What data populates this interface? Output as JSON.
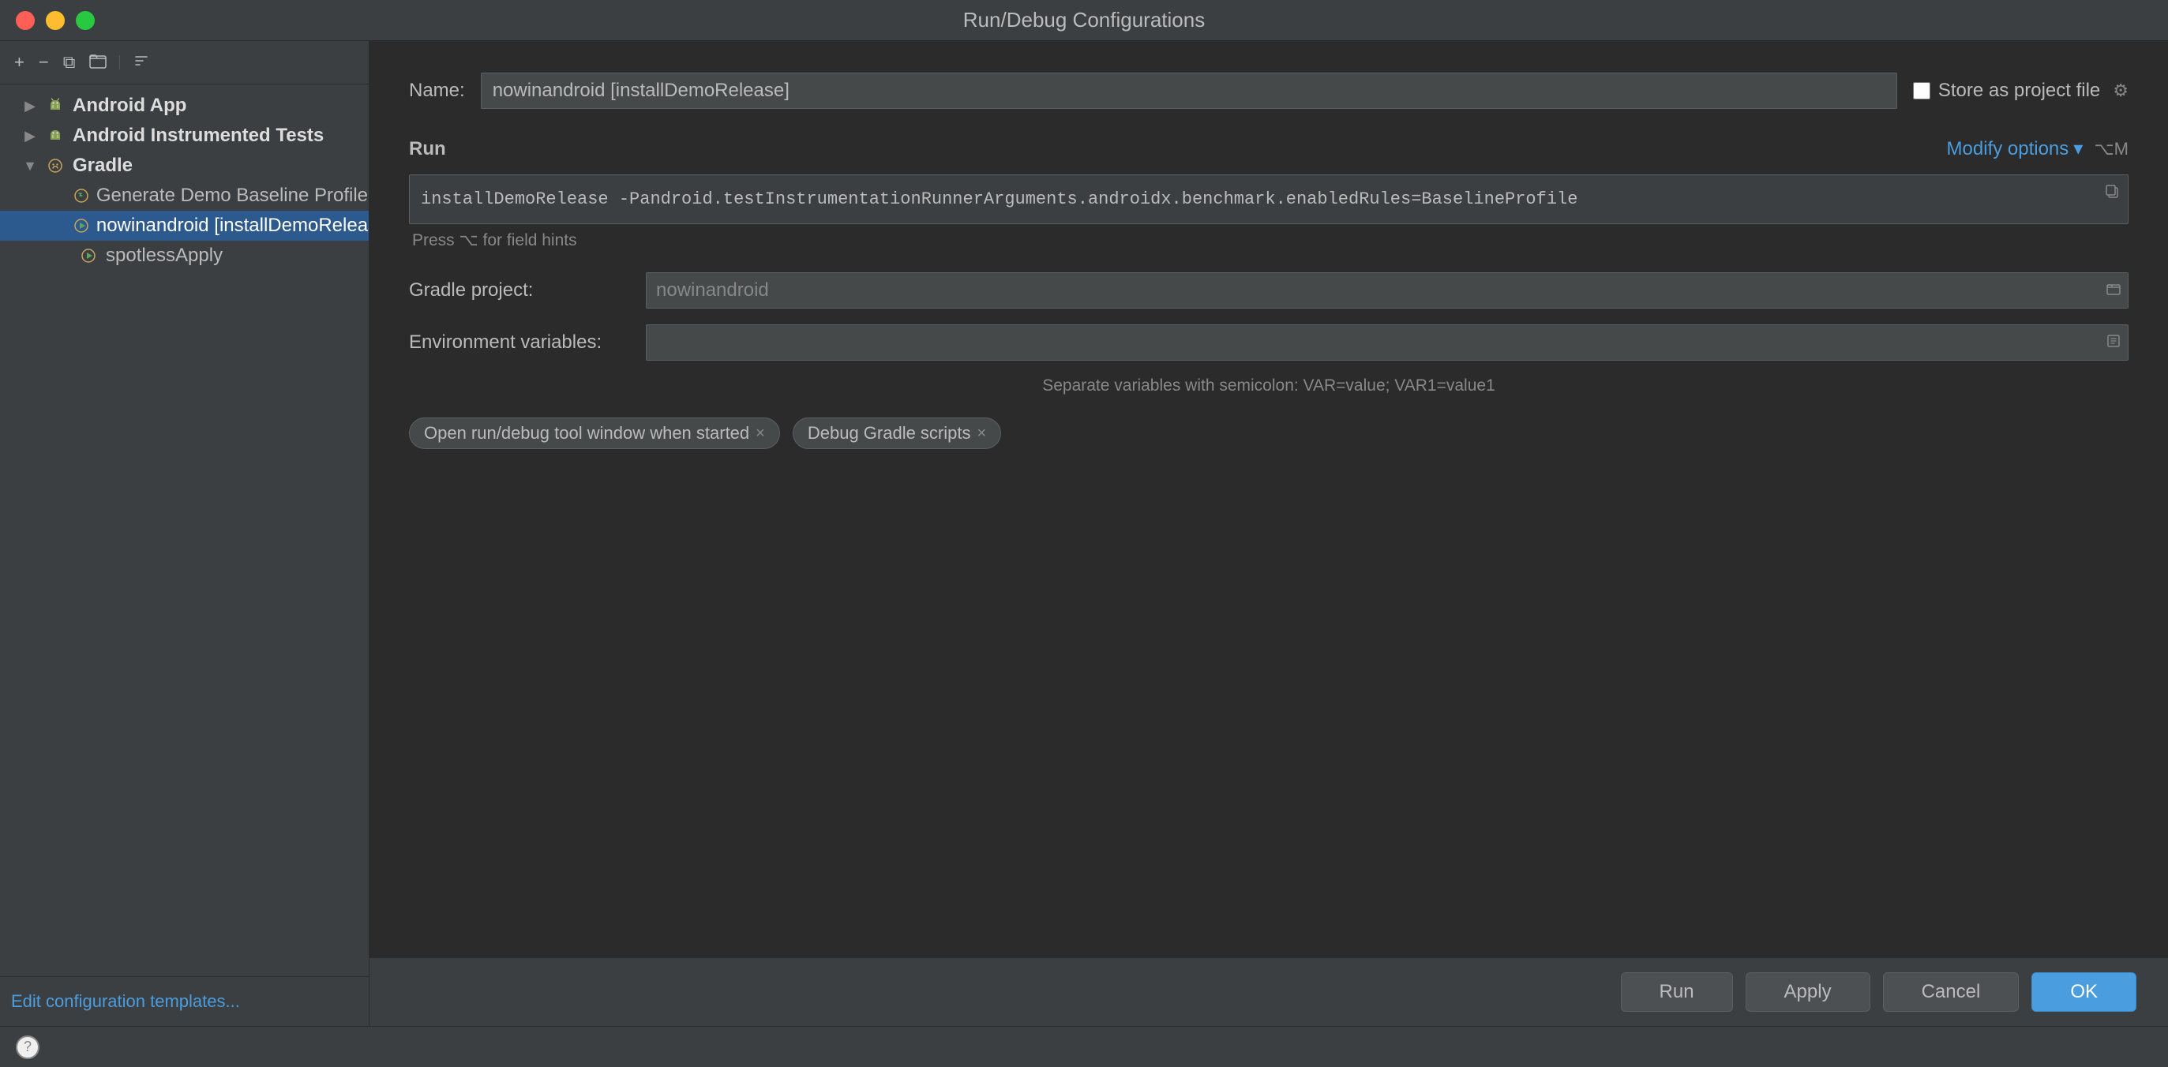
{
  "window": {
    "title": "Run/Debug Configurations"
  },
  "titlebar": {
    "title": "Run/Debug Configurations"
  },
  "sidebar": {
    "toolbar": {
      "add_label": "+",
      "remove_label": "−",
      "copy_label": "⧉",
      "folder_label": "📁",
      "sort_label": "⇅"
    },
    "tree": [
      {
        "id": "android-app",
        "level": 1,
        "arrow": "▶",
        "label": "Android App",
        "bold": true,
        "icon": "android"
      },
      {
        "id": "android-instrumented",
        "level": 1,
        "arrow": "▶",
        "label": "Android Instrumented Tests",
        "bold": true,
        "icon": "android"
      },
      {
        "id": "gradle",
        "level": 1,
        "arrow": "▼",
        "label": "Gradle",
        "bold": true,
        "icon": "gradle"
      },
      {
        "id": "generate-demo",
        "level": 2,
        "arrow": "",
        "label": "Generate Demo Baseline Profile",
        "bold": false,
        "icon": "run"
      },
      {
        "id": "nowinandroid-install",
        "level": 2,
        "arrow": "",
        "label": "nowinandroid [installDemoRelease]",
        "bold": false,
        "icon": "run",
        "selected": true
      },
      {
        "id": "spotless-apply",
        "level": 2,
        "arrow": "",
        "label": "spotlessApply",
        "bold": false,
        "icon": "run"
      }
    ],
    "edit_templates_label": "Edit configuration templates..."
  },
  "content": {
    "name_label": "Name:",
    "name_value": "nowinandroid [installDemoRelease]",
    "store_label": "Store as project file",
    "store_checked": false,
    "run_section_label": "Run",
    "modify_options_label": "Modify options",
    "modify_options_shortcut": "⌥M",
    "command_value": "installDemoRelease -Pandroid.testInstrumentationRunnerArguments.androidx.benchmark.enabledRules=BaselineProfile",
    "field_hints": "Press ⌥ for field hints",
    "gradle_project_label": "Gradle project:",
    "gradle_project_value": "nowinandroid",
    "env_variables_label": "Environment variables:",
    "env_variables_value": "",
    "semicolon_hint": "Separate variables with semicolon: VAR=value; VAR1=value1",
    "tags": [
      {
        "id": "open-tool-window",
        "label": "Open run/debug tool window when started"
      },
      {
        "id": "debug-gradle",
        "label": "Debug Gradle scripts"
      }
    ]
  },
  "bottom": {
    "help_label": "?",
    "run_label": "Run",
    "apply_label": "Apply",
    "cancel_label": "Cancel",
    "ok_label": "OK"
  }
}
